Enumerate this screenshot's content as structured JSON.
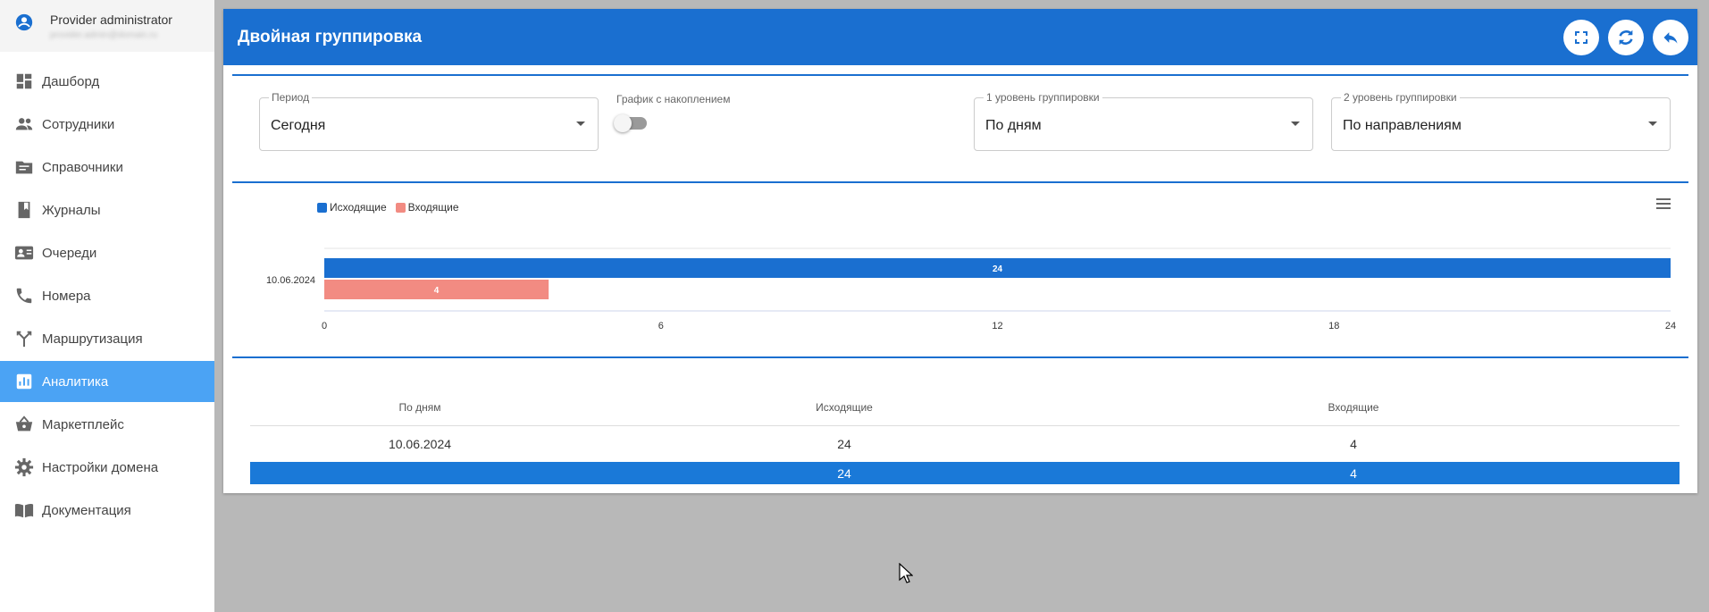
{
  "user": {
    "name": "Provider administrator",
    "sub": "provider.admin@domain.ru"
  },
  "nav": [
    {
      "label": "Дашборд",
      "icon": "dashboard-icon",
      "active": false
    },
    {
      "label": "Сотрудники",
      "icon": "people-icon",
      "active": false
    },
    {
      "label": "Справочники",
      "icon": "folder-icon",
      "active": false
    },
    {
      "label": "Журналы",
      "icon": "book-icon",
      "active": false
    },
    {
      "label": "Очереди",
      "icon": "contact-card-icon",
      "active": false
    },
    {
      "label": "Номера",
      "icon": "phone-icon",
      "active": false
    },
    {
      "label": "Маршрутизация",
      "icon": "routing-icon",
      "active": false
    },
    {
      "label": "Аналитика",
      "icon": "analytics-icon",
      "active": true
    },
    {
      "label": "Маркетплейс",
      "icon": "basket-icon",
      "active": false
    },
    {
      "label": "Настройки домена",
      "icon": "gear-icon",
      "active": false
    },
    {
      "label": "Документация",
      "icon": "docs-icon",
      "active": false
    }
  ],
  "header": {
    "title": "Двойная группировка"
  },
  "filters": {
    "period": {
      "label": "Период",
      "value": "Сегодня"
    },
    "cumulative": {
      "label": "График с накоплением",
      "on": false
    },
    "level1": {
      "label": "1 уровень группировки",
      "value": "По дням"
    },
    "level2": {
      "label": "2 уровень группировки",
      "value": "По направлениям"
    }
  },
  "colors": {
    "accent": "#1a6fd0",
    "outgoing": "#1a6fd0",
    "incoming": "#f28b82",
    "active_nav": "#4ba3f4"
  },
  "chart_data": {
    "type": "bar",
    "orientation": "horizontal",
    "categories": [
      "10.06.2024"
    ],
    "series": [
      {
        "name": "Исходящие",
        "values": [
          24
        ]
      },
      {
        "name": "Входящие",
        "values": [
          4
        ]
      }
    ],
    "xlim": [
      0,
      24
    ],
    "xticks": [
      0,
      6,
      12,
      18,
      24
    ],
    "legend": "top-left"
  },
  "table": {
    "headers": [
      "По дням",
      "Исходящие",
      "Входящие"
    ],
    "rows": [
      [
        "10.06.2024",
        "24",
        "4"
      ]
    ],
    "total": [
      "",
      "24",
      "4"
    ]
  }
}
